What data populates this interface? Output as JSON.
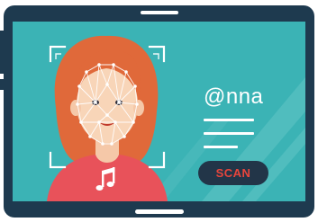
{
  "profile": {
    "username": "@nna"
  },
  "actions": {
    "scan_label": "SCAN"
  },
  "icons": {
    "music": "music-note-icon",
    "face_scan": "face-scan-frame-icon"
  },
  "colors": {
    "tablet_frame": "#1e3a4f",
    "screen_bg": "#3bb3b5",
    "scan_button_bg": "#223548",
    "scan_button_text": "#e8453c",
    "hair": "#e0693a",
    "shirt": "#e8525a"
  }
}
